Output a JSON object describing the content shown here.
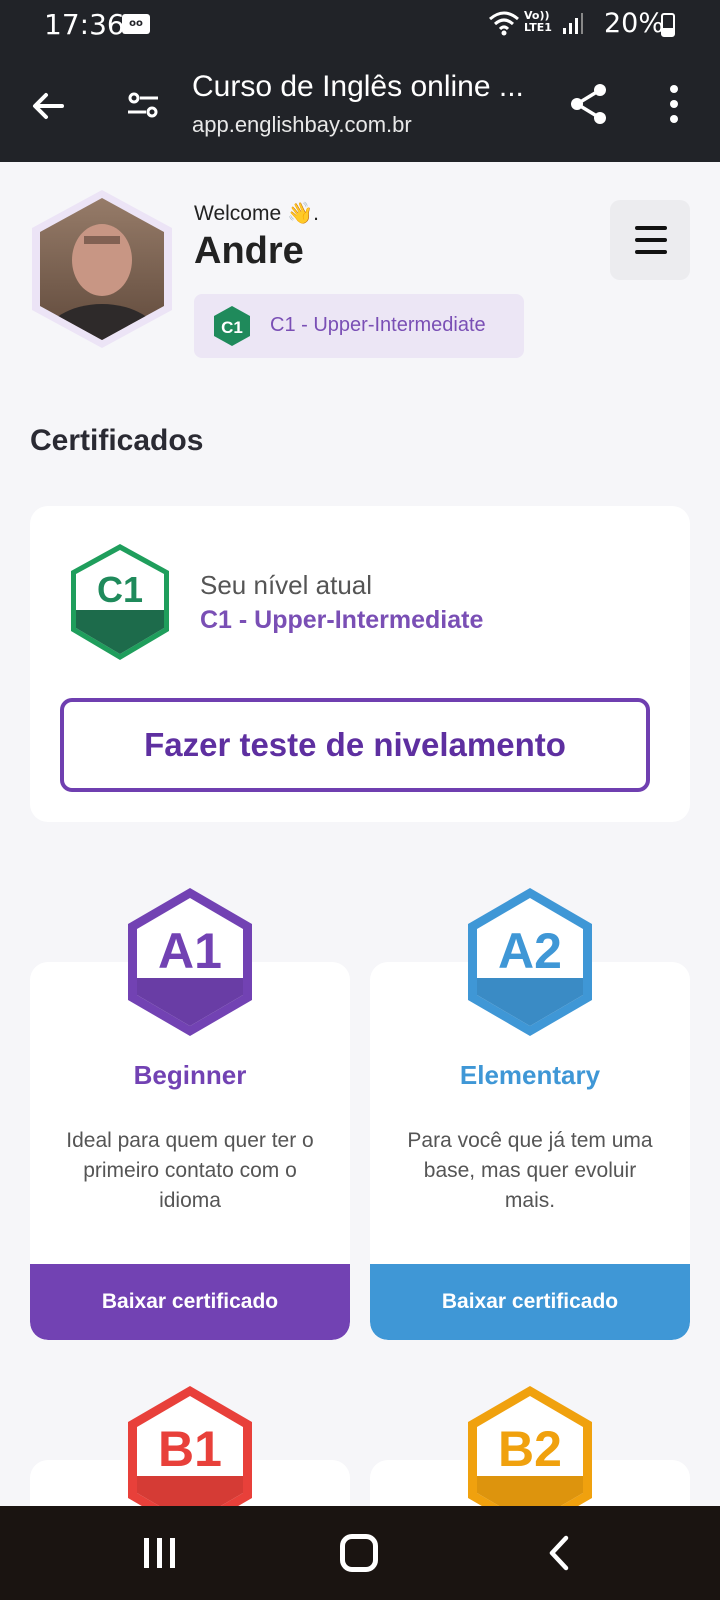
{
  "status_bar": {
    "time": "17:36",
    "network": "Vo)) LTE1",
    "battery": "20%"
  },
  "browser": {
    "title": "Curso de Inglês online ...",
    "url": "app.englishbay.com.br"
  },
  "profile": {
    "welcome": "Welcome 👋.",
    "name": "Andre",
    "level_badge": "C1",
    "level": "C1 - Upper-Intermediate"
  },
  "certificates": {
    "section_title": "Certificados",
    "current_label": "Seu nível atual",
    "current_level": "C1 - Upper-Intermediate",
    "current_badge": "C1",
    "test_button": "Fazer teste de nivelamento"
  },
  "levels": [
    {
      "badge": "A1",
      "name": "Beginner",
      "description": "Ideal para quem quer ter o primeiro contato com o idioma",
      "button": "Baixar certificado",
      "color": "#7242b3"
    },
    {
      "badge": "A2",
      "name": "Elementary",
      "description": "Para você que já tem uma base, mas quer evoluir mais.",
      "button": "Baixar certificado",
      "color": "#3f97d6"
    },
    {
      "badge": "B1",
      "color": "#e8403a"
    },
    {
      "badge": "B2",
      "color": "#f0a10e"
    }
  ],
  "colors": {
    "dark_bar": "#212328",
    "accent_purple": "#6f3fb0",
    "c1_green": "#1f8a5b"
  }
}
